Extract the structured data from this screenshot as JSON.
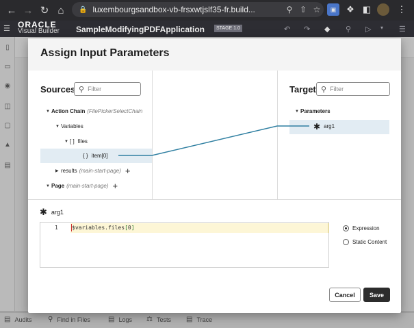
{
  "browser": {
    "url": "luxembourgsandbox-vb-frsxwtjslf35-fr.build..."
  },
  "vb_header": {
    "logo_brand": "ORACLE",
    "logo_product": "Visual Builder",
    "app_name": "SampleModifyingPDFApplication",
    "stage_badge": "STAGE 1.0"
  },
  "dialog": {
    "title": "Assign Input Parameters",
    "sources": {
      "title": "Sources",
      "filter_placeholder": "Filter",
      "tree": {
        "action_chain_label": "Action Chain",
        "action_chain_hint": "(FilePickerSelectChain",
        "variables_label": "Variables",
        "files_label": "files",
        "files_glyph": "[ ]",
        "item_label": "item[0]",
        "item_glyph": "{ }",
        "results_label": "results",
        "results_hint": "(main-start-page)",
        "page_label": "Page",
        "page_hint": "(main-start-page)"
      }
    },
    "target": {
      "title": "Target",
      "filter_placeholder": "Filter",
      "parameters_label": "Parameters",
      "arg_label": "arg1"
    },
    "editor": {
      "param_label": "arg1",
      "line_number": "1",
      "code_prefix": "$variables.files",
      "code_open": "[",
      "code_index": "0",
      "code_close": "]"
    },
    "mode": {
      "expression_label": "Expression",
      "static_label": "Static Content",
      "selected": "Expression"
    },
    "buttons": {
      "cancel_label": "Cancel",
      "save_label": "Save"
    }
  },
  "bottom_bar": {
    "items": [
      "Audits",
      "Find in Files",
      "Logs",
      "Tests",
      "Trace"
    ]
  },
  "colors": {
    "selection": "#e2ecf3",
    "mapping_line": "#2f7fa1",
    "save_button": "#2c2c2c"
  }
}
